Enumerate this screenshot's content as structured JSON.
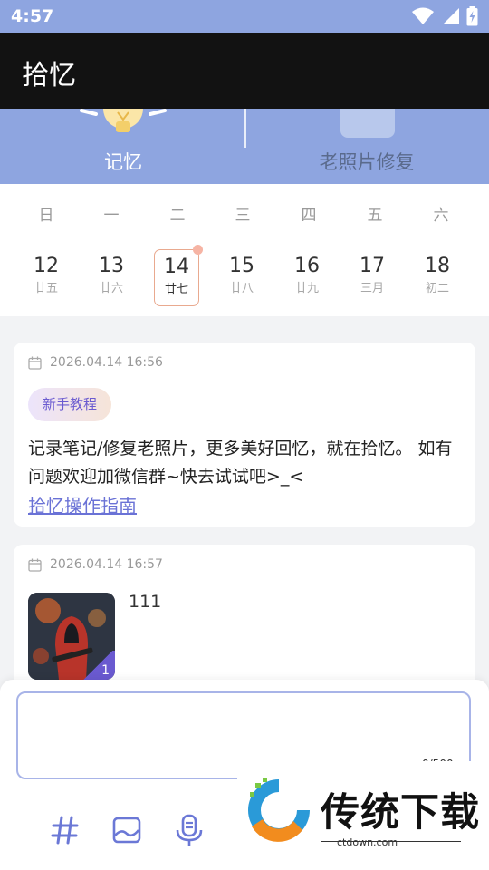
{
  "status_bar": {
    "time": "4:57"
  },
  "app_bar": {
    "title": "拾忆"
  },
  "feature_tabs": [
    {
      "label": "记忆",
      "active": true
    },
    {
      "label": "老照片修复",
      "active": false
    }
  ],
  "calendar": {
    "weekdays": [
      "日",
      "一",
      "二",
      "三",
      "四",
      "五",
      "六"
    ],
    "days": [
      {
        "num": "12",
        "lunar": "廿五"
      },
      {
        "num": "13",
        "lunar": "廿六"
      },
      {
        "num": "14",
        "lunar": "廿七",
        "selected": true
      },
      {
        "num": "15",
        "lunar": "廿八"
      },
      {
        "num": "16",
        "lunar": "廿九"
      },
      {
        "num": "17",
        "lunar": "三月"
      },
      {
        "num": "18",
        "lunar": "初二"
      }
    ]
  },
  "entries": [
    {
      "date": "2026.04.14 16:56",
      "tag": "新手教程",
      "body": "记录笔记/修复老照片，更多美好回忆，就在拾忆。 如有问题欢迎加微信群~快去试试吧>_<",
      "link": "拾忆操作指南"
    },
    {
      "date": "2026.04.14 16:57",
      "title": "111",
      "image_count": "1"
    }
  ],
  "composer": {
    "placeholder": "",
    "char_count": "0/500",
    "tools": [
      "hash-icon",
      "image-icon",
      "microphone-icon"
    ]
  },
  "watermark": {
    "text": "传统下载",
    "sub": "ctdown.com"
  },
  "colors": {
    "accent": "#8ea5e0",
    "link": "#6a72d6",
    "tag_text": "#6b5bd0",
    "selected_border": "#e9a98f"
  }
}
